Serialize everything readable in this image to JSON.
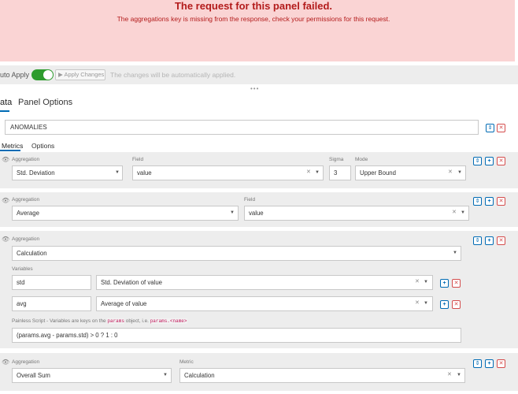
{
  "error": {
    "title": "The request for this panel failed.",
    "message": "The aggregations key is missing from the response, check your permissions for this request."
  },
  "apply_bar": {
    "auto_apply_label": "uto Apply",
    "apply_button": "▶ Apply Changes",
    "note": "The changes will be automatically applied.",
    "toggle_on": true
  },
  "tabs": [
    "ata",
    "Panel Options"
  ],
  "series": {
    "label_value": "ANOMALIES",
    "sub_tabs": [
      "Metrics",
      "Options"
    ]
  },
  "metrics": [
    {
      "aggregation_label": "Aggregation",
      "aggregation": "Std. Deviation",
      "field_label": "Field",
      "field": "value",
      "sigma_label": "Sigma",
      "sigma": "3",
      "mode_label": "Mode",
      "mode": "Upper Bound"
    },
    {
      "aggregation_label": "Aggregation",
      "aggregation": "Average",
      "field_label": "Field",
      "field": "value"
    },
    {
      "aggregation_label": "Aggregation",
      "aggregation": "Calculation",
      "variables_label": "Variables",
      "variables": [
        {
          "name": "std",
          "metric": "Std. Deviation of value"
        },
        {
          "name": "avg",
          "metric": "Average of value"
        }
      ],
      "script_hint_prefix": "Painless Script - Variables are keys on the",
      "script_hint_code1": "params",
      "script_hint_mid": "object, i.e.",
      "script_hint_code2": "params.<name>",
      "script": "(params.avg - params.std) > 0 ? 1 : 0"
    },
    {
      "aggregation_label": "Aggregation",
      "aggregation": "Overall Sum",
      "metric_label": "Metric",
      "metric": "Calculation"
    }
  ],
  "icons": {
    "eye": "eye-icon",
    "sort": "sort-icon",
    "add": "plus-icon",
    "delete": "trash-icon",
    "caret": "chevron-down-icon",
    "clear": "clear-icon"
  },
  "colors": {
    "error_bg": "#fad4d4",
    "error_text": "#b31b1b",
    "toggle": "#2e9c2e",
    "accent": "#006bb4",
    "danger": "#d44c4c"
  }
}
